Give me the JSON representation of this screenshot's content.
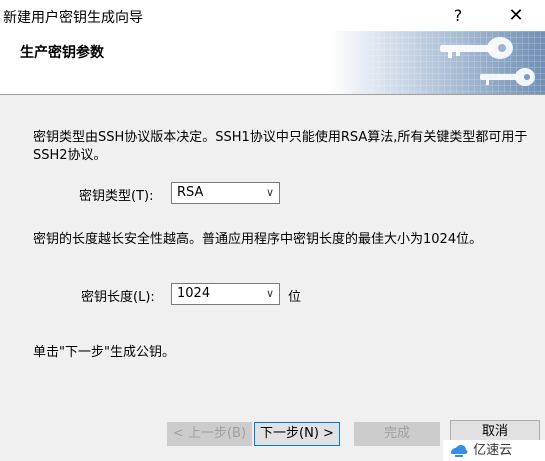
{
  "window": {
    "title": "新建用户密钥生成向导",
    "help_glyph": "?",
    "close_glyph": "✕"
  },
  "header": {
    "title": "生产密钥参数"
  },
  "body": {
    "paragraph1": "密钥类型由SSH协议版本决定。SSH1协议中只能使用RSA算法,所有关键类型都可用于SSH2协议。",
    "key_type_label": "密钥类型(T):",
    "key_type_value": "RSA",
    "paragraph2": "密钥的长度越长安全性越高。普通应用程序中密钥长度的最佳大小为1024位。",
    "key_length_label": "密钥长度(L):",
    "key_length_value": "1024",
    "key_length_unit": "位",
    "paragraph3": "单击\"下一步\"生成公钥。"
  },
  "buttons": {
    "back": "< 上一步(B)",
    "next": "下一步(N) >",
    "finish": "完成",
    "cancel": "取消"
  },
  "watermark": {
    "text": "亿速云"
  },
  "icons": {
    "header_art": "keys-icon",
    "dropdown": "chevron-down-icon"
  }
}
